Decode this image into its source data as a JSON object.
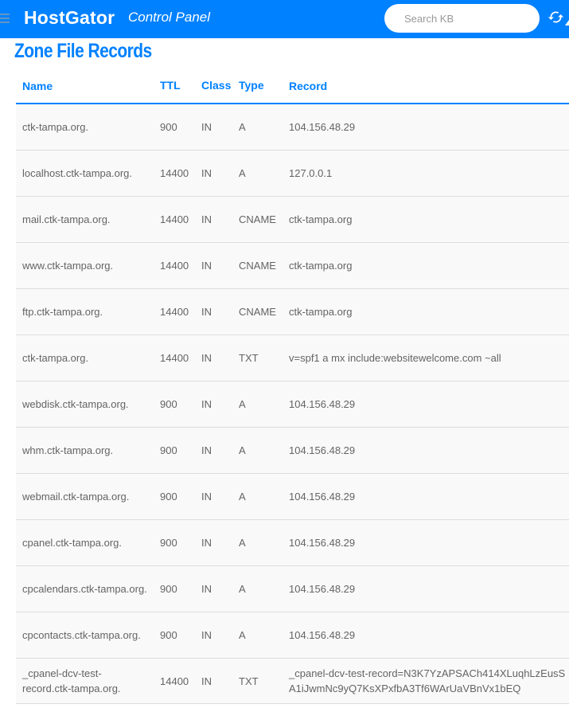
{
  "header": {
    "logo": "HostGator",
    "logo_suffix": "Control Panel",
    "search_placeholder": "Search KB",
    "bar_color": "#0081ff"
  },
  "page": {
    "title": "Zone File Records"
  },
  "table": {
    "columns": [
      "Name",
      "TTL",
      "Class",
      "Type",
      "Record"
    ],
    "rows": [
      {
        "name": "ctk-tampa.org.",
        "ttl": "900",
        "class": "IN",
        "type": "A",
        "record": "104.156.48.29"
      },
      {
        "name": "localhost.ctk-tampa.org.",
        "ttl": "14400",
        "class": "IN",
        "type": "A",
        "record": "127.0.0.1"
      },
      {
        "name": "mail.ctk-tampa.org.",
        "ttl": "14400",
        "class": "IN",
        "type": "CNAME",
        "record": "ctk-tampa.org"
      },
      {
        "name": "www.ctk-tampa.org.",
        "ttl": "14400",
        "class": "IN",
        "type": "CNAME",
        "record": "ctk-tampa.org"
      },
      {
        "name": "ftp.ctk-tampa.org.",
        "ttl": "14400",
        "class": "IN",
        "type": "CNAME",
        "record": "ctk-tampa.org"
      },
      {
        "name": "ctk-tampa.org.",
        "ttl": "14400",
        "class": "IN",
        "type": "TXT",
        "record": "v=spf1 a mx include:websitewelcome.com ~all"
      },
      {
        "name": "webdisk.ctk-tampa.org.",
        "ttl": "900",
        "class": "IN",
        "type": "A",
        "record": "104.156.48.29"
      },
      {
        "name": "whm.ctk-tampa.org.",
        "ttl": "900",
        "class": "IN",
        "type": "A",
        "record": "104.156.48.29"
      },
      {
        "name": "webmail.ctk-tampa.org.",
        "ttl": "900",
        "class": "IN",
        "type": "A",
        "record": "104.156.48.29"
      },
      {
        "name": "cpanel.ctk-tampa.org.",
        "ttl": "900",
        "class": "IN",
        "type": "A",
        "record": "104.156.48.29"
      },
      {
        "name": "cpcalendars.ctk-tampa.org.",
        "ttl": "900",
        "class": "IN",
        "type": "A",
        "record": "104.156.48.29"
      },
      {
        "name": "cpcontacts.ctk-tampa.org.",
        "ttl": "900",
        "class": "IN",
        "type": "A",
        "record": "104.156.48.29"
      },
      {
        "name": "_cpanel-dcv-test-record.ctk-tampa.org.",
        "ttl": "14400",
        "class": "IN",
        "type": "TXT",
        "record": "_cpanel-dcv-test-record=N3K7YzAPSACh414XLuqhLzEusSA1iJwmNc9yQ7KsXPxfbA3Tf6WArUaVBnVx1bEQ"
      }
    ]
  }
}
